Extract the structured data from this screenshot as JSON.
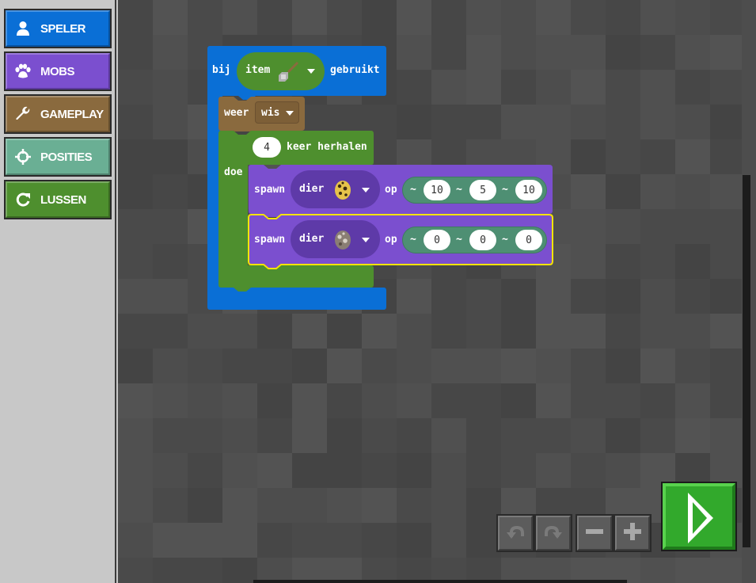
{
  "sidebar": {
    "categories": [
      {
        "label": "SPELER",
        "icon": "person-icon",
        "color": "#0a6fd6"
      },
      {
        "label": "MOBS",
        "icon": "paw-icon",
        "color": "#7b4fcf"
      },
      {
        "label": "GAMEPLAY",
        "icon": "wrench-icon",
        "color": "#8a6a3e"
      },
      {
        "label": "POSITIES",
        "icon": "crosshair-icon",
        "color": "#6aaf94"
      },
      {
        "label": "LUSSEN",
        "icon": "loop-icon",
        "color": "#4e8f2e"
      }
    ]
  },
  "blocks": {
    "event": {
      "prefix": "bij",
      "item_label": "item",
      "item_icon": "shovel-icon",
      "suffix": "gebruikt",
      "color": "#0a6fd6"
    },
    "weather": {
      "label": "weer",
      "value": "wis",
      "color": "#8a6a3e"
    },
    "repeat": {
      "count": "4",
      "label": "keer herhalen",
      "do_label": "doe",
      "color": "#4e8f2e"
    },
    "spawns": [
      {
        "label": "spawn",
        "animal_label": "dier",
        "egg_icon": "ocelot-egg-icon",
        "at_label": "op",
        "tilde": "~",
        "x": "10",
        "y": "5",
        "z": "10"
      },
      {
        "label": "spawn",
        "animal_label": "dier",
        "egg_icon": "spider-egg-icon",
        "at_label": "op",
        "tilde": "~",
        "x": "0",
        "y": "0",
        "z": "0"
      }
    ],
    "spawn_color": "#7b4fcf",
    "position_color": "#4e8f73"
  },
  "controls": {
    "undo": "undo-icon",
    "redo": "redo-icon",
    "zoom_out": "minus-icon",
    "zoom_in": "plus-icon",
    "run": "play-icon"
  }
}
